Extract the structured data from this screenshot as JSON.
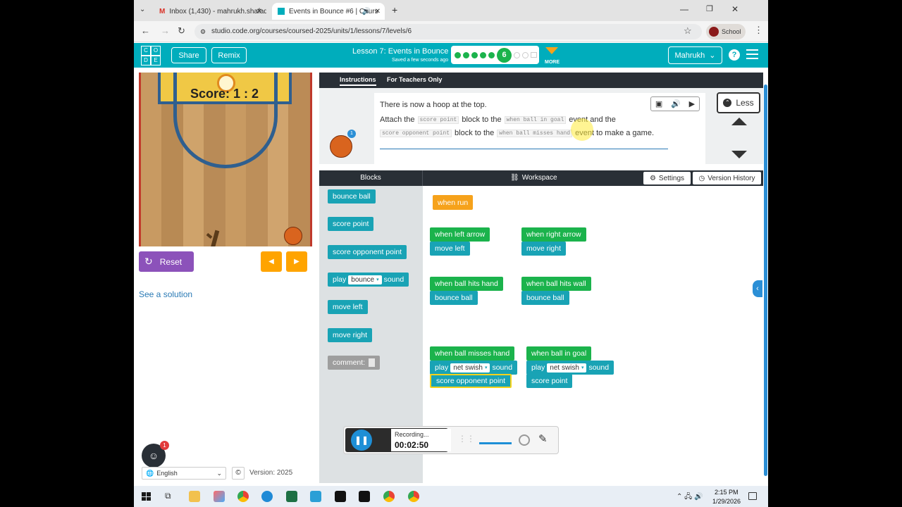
{
  "browser": {
    "tabs": [
      {
        "label": "Inbox (1,430) - mahrukh.shafaq"
      },
      {
        "label": "Events in Bounce #6 | Cours"
      }
    ],
    "url": "studio.code.org/courses/coursed-2025/units/1/lessons/7/levels/6",
    "profile": "School"
  },
  "header": {
    "logo_letters": [
      "C",
      "O",
      "D",
      "E"
    ],
    "share": "Share",
    "remix": "Remix",
    "lesson_title": "Lesson 7: Events in Bounce",
    "saved": "Saved a few seconds ago",
    "current_level": "6",
    "more": "MORE",
    "user": "Mahrukh"
  },
  "game": {
    "score": "Score: 1 : 2",
    "reset": "Reset",
    "see_solution": "See a solution"
  },
  "instructions": {
    "tab_instructions": "Instructions",
    "tab_teachers": "For Teachers Only",
    "line1": "There is now a hoop at the top.",
    "attach": "Attach the",
    "code_score_point": "score point",
    "block_to_the": "block to the",
    "code_when_ball_in_goal": "when ball in goal",
    "event_and_the": "event and the",
    "code_score_opponent": "score opponent point",
    "block_to_the2": "block to the",
    "code_when_ball_misses": "when ball misses hand",
    "event_to_make": "event to make a game.",
    "less": "Less",
    "badge": "1"
  },
  "toolbox": {
    "header": "Blocks",
    "blocks": [
      "bounce ball",
      "score point",
      "score opponent point",
      "play",
      "bounce",
      "sound",
      "move left",
      "move right",
      "comment:"
    ]
  },
  "workspace": {
    "header": "Workspace",
    "settings": "Settings",
    "version_history": "Version History",
    "when_run": "when run",
    "when_left_arrow": "when left arrow",
    "move_left": "move left",
    "when_right_arrow": "when right arrow",
    "move_right": "move right",
    "when_ball_hits_hand": "when ball hits hand",
    "bounce_ball": "bounce ball",
    "when_ball_hits_wall": "when ball hits wall",
    "bounce_ball2": "bounce ball",
    "when_ball_misses_hand": "when ball misses hand",
    "play": "play",
    "net_swish": "net swish",
    "sound": "sound",
    "score_opponent_point": "score opponent point",
    "when_ball_in_goal": "when ball in goal",
    "play2": "play",
    "net_swish2": "net swish",
    "sound2": "sound",
    "score_point": "score point"
  },
  "recorder": {
    "status": "Recording...",
    "time": "00:02:50"
  },
  "footer": {
    "language": "English",
    "version": "Version: 2025",
    "assistant_badge": "1"
  },
  "taskbar": {
    "time": "2:15 PM",
    "date": "1/29/2026"
  }
}
